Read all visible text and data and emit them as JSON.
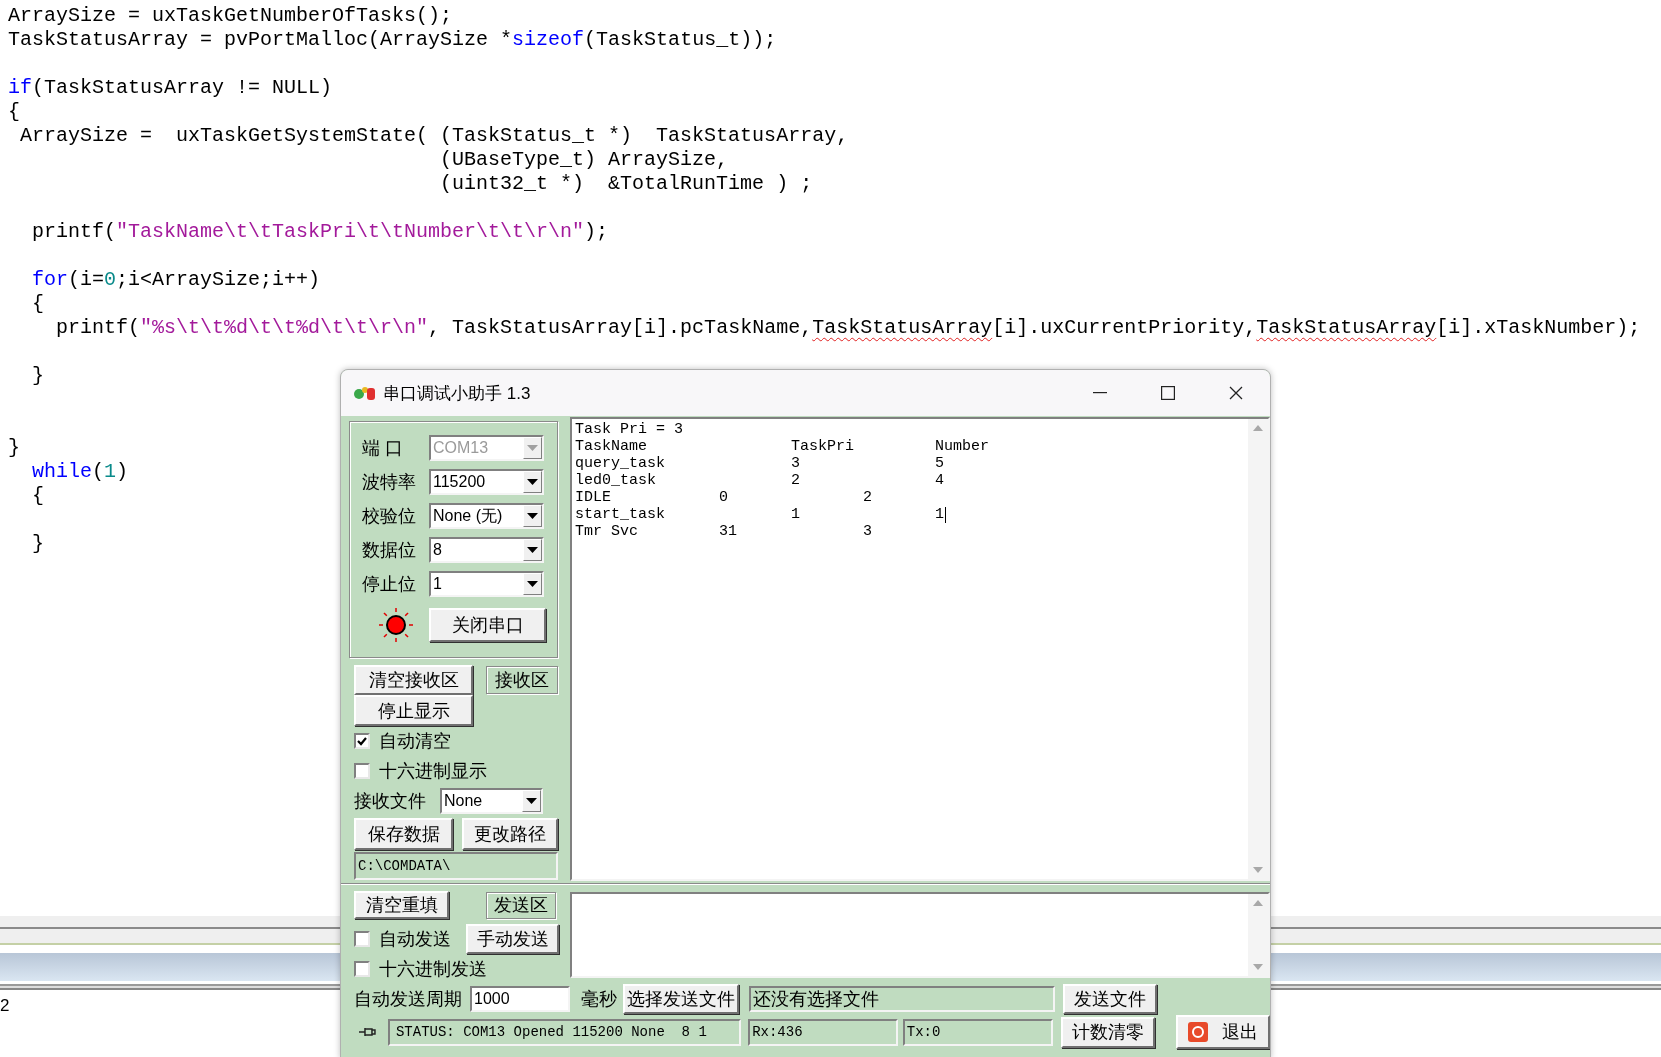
{
  "editor": {
    "lines": [
      {
        "kind": "code",
        "tokens": [
          {
            "kind": "plain",
            "text": "ArraySize = uxTaskGetNumberOfTasks();"
          }
        ]
      },
      {
        "kind": "code",
        "tokens": [
          {
            "kind": "plain",
            "text": "TaskStatusArray = pvPortMalloc(ArraySize *"
          },
          {
            "kind": "keyword",
            "text": "sizeof"
          },
          {
            "kind": "plain",
            "text": "(TaskStatus_t));"
          }
        ]
      },
      {
        "kind": "blank"
      },
      {
        "kind": "code",
        "tokens": [
          {
            "kind": "keyword",
            "text": "if"
          },
          {
            "kind": "plain",
            "text": "(TaskStatusArray != NULL)"
          }
        ]
      },
      {
        "kind": "code",
        "tokens": [
          {
            "kind": "plain",
            "text": "{"
          }
        ]
      },
      {
        "kind": "code",
        "tokens": [
          {
            "kind": "plain",
            "text": " ArraySize =  uxTaskGetSystemState( (TaskStatus_t *)  TaskStatusArray,"
          }
        ]
      },
      {
        "kind": "code",
        "tokens": [
          {
            "kind": "plain",
            "text": "                                    (UBaseType_t) ArraySize,"
          }
        ]
      },
      {
        "kind": "code",
        "tokens": [
          {
            "kind": "plain",
            "text": "                                    (uint32_t *)  &TotalRunTime ) ;"
          }
        ]
      },
      {
        "kind": "blank"
      },
      {
        "kind": "code",
        "tokens": [
          {
            "kind": "plain",
            "text": "  printf("
          },
          {
            "kind": "string",
            "text": "\"TaskName\\t\\tTaskPri\\t\\tNumber\\t\\t\\r\\n\""
          },
          {
            "kind": "plain",
            "text": ");"
          }
        ]
      },
      {
        "kind": "blank"
      },
      {
        "kind": "code",
        "tokens": [
          {
            "kind": "keyword",
            "text": "  for"
          },
          {
            "kind": "plain",
            "text": "(i="
          },
          {
            "kind": "number",
            "text": "0"
          },
          {
            "kind": "plain",
            "text": ";i<ArraySize;i++)"
          }
        ]
      },
      {
        "kind": "code",
        "tokens": [
          {
            "kind": "plain",
            "text": "  {"
          }
        ]
      },
      {
        "kind": "code",
        "tokens": [
          {
            "kind": "plain",
            "text": "    printf("
          },
          {
            "kind": "string",
            "text": "\"%s\\t\\t%d\\t\\t%d\\t\\t\\r\\n\""
          },
          {
            "kind": "plain",
            "text": ", TaskStatusArray[i].pcTaskName,"
          },
          {
            "kind": "flagged",
            "text": "TaskStatusArray"
          },
          {
            "kind": "plain",
            "text": "[i].uxCurrentPriority,"
          },
          {
            "kind": "flagged",
            "text": "TaskStatusArray"
          },
          {
            "kind": "plain",
            "text": "[i].xTaskNumber);"
          }
        ]
      },
      {
        "kind": "blank"
      },
      {
        "kind": "code",
        "tokens": [
          {
            "kind": "plain",
            "text": "  }"
          }
        ]
      },
      {
        "kind": "blank"
      },
      {
        "kind": "blank"
      },
      {
        "kind": "code",
        "tokens": [
          {
            "kind": "plain",
            "text": "}"
          }
        ]
      },
      {
        "kind": "code",
        "tokens": [
          {
            "kind": "keyword",
            "text": "  while"
          },
          {
            "kind": "plain",
            "text": "("
          },
          {
            "kind": "number",
            "text": "1"
          },
          {
            "kind": "plain",
            "text": ")"
          }
        ]
      },
      {
        "kind": "code",
        "tokens": [
          {
            "kind": "plain",
            "text": "  {"
          }
        ]
      },
      {
        "kind": "blank"
      },
      {
        "kind": "code",
        "tokens": [
          {
            "kind": "plain",
            "text": "  }"
          }
        ]
      }
    ]
  },
  "background_panel": {
    "text": "2"
  },
  "serial_window": {
    "title": "串口调试小助手 1.3",
    "settings": [
      {
        "label": "端 口",
        "value": "COM13",
        "disabled": true
      },
      {
        "label": "波特率",
        "value": "115200",
        "disabled": false
      },
      {
        "label": "校验位",
        "value": "None (无)",
        "disabled": false
      },
      {
        "label": "数据位",
        "value": "8",
        "disabled": false
      },
      {
        "label": "停止位",
        "value": "1",
        "disabled": false
      }
    ],
    "port_indicator": {
      "on": true
    },
    "open_button": "关闭串口",
    "receive": {
      "clear_button": "清空接收区",
      "area_label": "接收区",
      "pause_button": "停止显示",
      "options": [
        {
          "label": "自动清空",
          "checked": true
        },
        {
          "label": "十六进制显示",
          "checked": false
        }
      ],
      "file_label": "接收文件",
      "file_value": "None",
      "save_button": "保存数据",
      "path_button": "更改路径",
      "path": "C:\\COMDATA\\",
      "lines": [
        {
          "text": "Task Pri = 3",
          "caret": false
        },
        {
          "text": "TaskName                TaskPri         Number",
          "caret": false
        },
        {
          "text": "query_task              3               5",
          "caret": false
        },
        {
          "text": "led0_task               2               4",
          "caret": false
        },
        {
          "text": "IDLE            0               2",
          "caret": false
        },
        {
          "text": "start_task              1               1",
          "caret": true
        },
        {
          "text": "Tmr Svc         31              3",
          "caret": false
        }
      ]
    },
    "send": {
      "clear_button": "清空重填",
      "area_label": "发送区",
      "auto_send": {
        "label": "自动发送",
        "checked": false
      },
      "manual_button": "手动发送",
      "hex_send": {
        "label": "十六进制发送",
        "checked": false
      },
      "period_label": "自动发送周期",
      "period_value": "1000",
      "period_unit": "毫秒",
      "choose_file_button": "选择发送文件",
      "file_status": "还没有选择文件",
      "send_file_button": "发送文件"
    },
    "status_bar": {
      "status": "STATUS: COM13 Opened 115200 None  8 1",
      "rx": "Rx:436",
      "tx": "Tx:0",
      "reset_button": "计数清零",
      "exit_button": "退出"
    }
  }
}
